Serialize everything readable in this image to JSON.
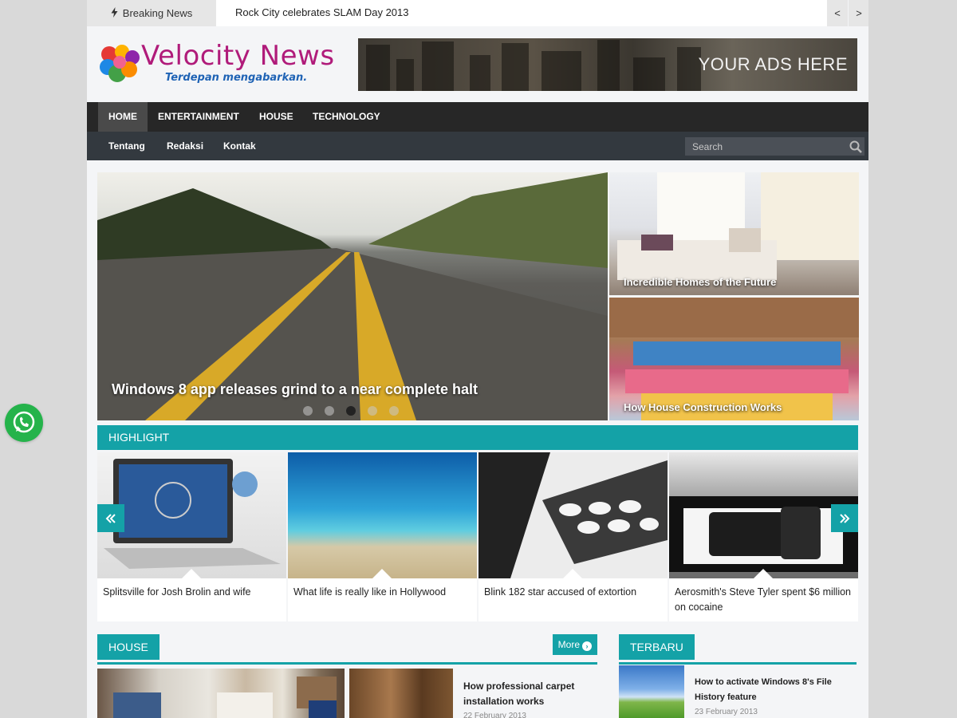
{
  "topbar": {
    "breaking_label": "Breaking News",
    "breaking_icon": "bolt-icon",
    "headline": "Rock City celebrates SLAM Day 2013",
    "prev_label": "<",
    "next_label": ">"
  },
  "header": {
    "site_title": "Velocity News",
    "tagline": "Terdepan mengabarkan.",
    "ad_text": "YOUR ADS HERE"
  },
  "nav": {
    "main": [
      "HOME",
      "ENTERTAINMENT",
      "HOUSE",
      "TECHNOLOGY"
    ],
    "active": "HOME",
    "sub": [
      "Tentang",
      "Redaksi",
      "Kontak"
    ],
    "search_placeholder": "Search"
  },
  "featured": {
    "main_caption": "Windows 8 app releases grind to a near complete halt",
    "slide_count": 5,
    "active_slide": 3,
    "side": [
      {
        "caption": "Incredible Homes of the Future"
      },
      {
        "caption": "How House Construction Works"
      }
    ]
  },
  "highlight": {
    "title": "HIGHLIGHT",
    "prev_icon": "double-chevron-left-icon",
    "next_icon": "double-chevron-right-icon",
    "items": [
      {
        "caption": "Splitsville for Josh Brolin and wife"
      },
      {
        "caption": "What life is really like in Hollywood"
      },
      {
        "caption": "Blink 182 star accused of extortion"
      },
      {
        "caption": "Aerosmith's Steve Tyler spent $6 million on cocaine"
      }
    ]
  },
  "house_section": {
    "title": "HOUSE",
    "more_label": "More",
    "post": {
      "title": "How professional carpet installation works",
      "date": "22 February 2013"
    }
  },
  "terbaru_section": {
    "title": "TERBARU",
    "post": {
      "title": "How to activate Windows 8's File History feature",
      "date": "23 February 2013"
    }
  },
  "colors": {
    "accent": "#14a2a7",
    "nav_dark": "#272727",
    "nav_sub": "#33393f",
    "whatsapp": "#25b34b"
  }
}
